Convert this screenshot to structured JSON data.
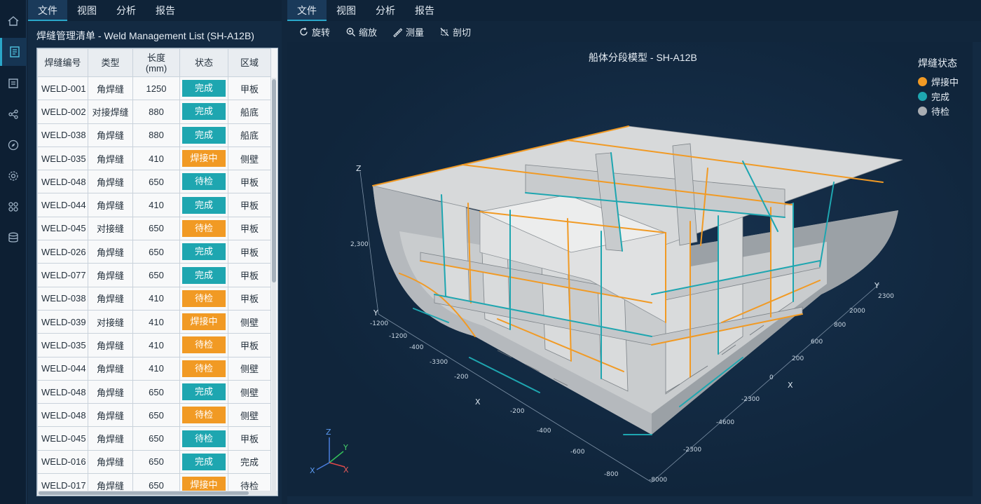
{
  "left_menu": [
    "文件",
    "视图",
    "分析",
    "报告"
  ],
  "right_menu": [
    "文件",
    "视图",
    "分析",
    "报告"
  ],
  "panel_title": "焊缝管理清单 - Weld Management List (SH-A12B)",
  "table": {
    "headers": [
      "焊缝编号",
      "类型",
      "长度\n(mm)",
      "状态",
      "区域"
    ],
    "rows": [
      {
        "id": "WELD-001",
        "type": "角焊缝",
        "length": "1250",
        "status": "完成",
        "status_color": "#1ea6b0",
        "zone": "甲板"
      },
      {
        "id": "WELD-002",
        "type": "对接焊缝",
        "length": "880",
        "status": "完成",
        "status_color": "#1ea6b0",
        "zone": "船底"
      },
      {
        "id": "WELD-038",
        "type": "角焊缝",
        "length": "880",
        "status": "完成",
        "status_color": "#1ea6b0",
        "zone": "船底"
      },
      {
        "id": "WELD-035",
        "type": "角焊缝",
        "length": "410",
        "status": "焊接中",
        "status_color": "#f19a24",
        "zone": "侧壁"
      },
      {
        "id": "WELD-048",
        "type": "角焊缝",
        "length": "650",
        "status": "待检",
        "status_color": "#1ea6b0",
        "zone": "甲板"
      },
      {
        "id": "WELD-044",
        "type": "角焊缝",
        "length": "410",
        "status": "完成",
        "status_color": "#1ea6b0",
        "zone": "甲板"
      },
      {
        "id": "WELD-045",
        "type": "对接缝",
        "length": "650",
        "status": "待检",
        "status_color": "#f19a24",
        "zone": "甲板"
      },
      {
        "id": "WELD-026",
        "type": "角焊缝",
        "length": "650",
        "status": "完成",
        "status_color": "#1ea6b0",
        "zone": "甲板"
      },
      {
        "id": "WELD-077",
        "type": "角焊缝",
        "length": "650",
        "status": "完成",
        "status_color": "#1ea6b0",
        "zone": "甲板"
      },
      {
        "id": "WELD-038",
        "type": "角焊缝",
        "length": "410",
        "status": "待检",
        "status_color": "#f19a24",
        "zone": "甲板"
      },
      {
        "id": "WELD-039",
        "type": "对接缝",
        "length": "410",
        "status": "焊接中",
        "status_color": "#f19a24",
        "zone": "侧壁"
      },
      {
        "id": "WELD-035",
        "type": "角焊缝",
        "length": "410",
        "status": "待检",
        "status_color": "#f19a24",
        "zone": "甲板"
      },
      {
        "id": "WELD-044",
        "type": "角焊缝",
        "length": "410",
        "status": "待检",
        "status_color": "#f19a24",
        "zone": "侧壁"
      },
      {
        "id": "WELD-048",
        "type": "角焊缝",
        "length": "650",
        "status": "完成",
        "status_color": "#1ea6b0",
        "zone": "侧壁"
      },
      {
        "id": "WELD-048",
        "type": "角焊缝",
        "length": "650",
        "status": "待检",
        "status_color": "#f19a24",
        "zone": "侧壁"
      },
      {
        "id": "WELD-045",
        "type": "角焊缝",
        "length": "650",
        "status": "待检",
        "status_color": "#1ea6b0",
        "zone": "甲板"
      },
      {
        "id": "WELD-016",
        "type": "角焊缝",
        "length": "650",
        "status": "完成",
        "status_color": "#1ea6b0",
        "zone": "完成"
      },
      {
        "id": "WELD-017",
        "type": "角焊缝",
        "length": "650",
        "status": "焊接中",
        "status_color": "#f19a24",
        "zone": "待检"
      }
    ]
  },
  "toolbar": {
    "rotate": "旋转",
    "zoom": "缩放",
    "measure": "测量",
    "section": "剖切"
  },
  "viewer": {
    "model_title": "船体分段模型 - SH-A12B",
    "legend_title": "焊缝状态",
    "legend": [
      {
        "label": "焊接中",
        "color": "#f19a24"
      },
      {
        "label": "完成",
        "color": "#1ea6b0"
      },
      {
        "label": "待检",
        "color": "#a9adb2"
      }
    ],
    "axis_labels": {
      "z": "Z",
      "y_left": "Y",
      "x_left": "X",
      "y_right": "Y",
      "x_right": "X"
    },
    "z_ticks": [
      "2,300"
    ],
    "left_x_ticks": [
      "-1200",
      "-1200",
      "-400",
      "-3300",
      "-200",
      "-200",
      "-400",
      "-600",
      "-800"
    ],
    "right_ticks": [
      "2300",
      "2000",
      "800",
      "600",
      "200",
      "0",
      "-2300",
      "-4600",
      "-2300",
      "-8000"
    ],
    "triad": {
      "z": "Z",
      "y": "Y",
      "x": "X"
    }
  }
}
